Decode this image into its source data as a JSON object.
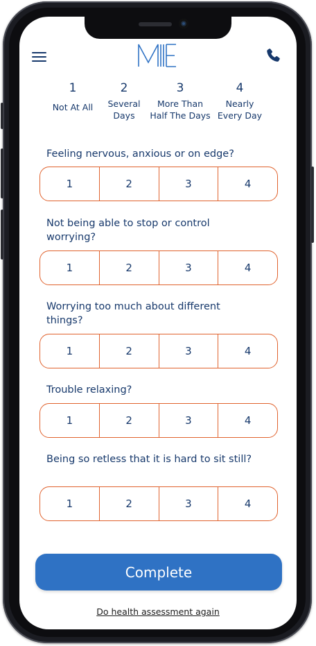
{
  "header": {
    "menu_icon": "hamburger-menu-icon",
    "logo_text": "ME",
    "phone_icon": "phone-icon",
    "accent_color": "#16386b"
  },
  "scale": [
    {
      "number": "1",
      "line1": "Not At All",
      "line2": ""
    },
    {
      "number": "2",
      "line1": "Several",
      "line2": "Days"
    },
    {
      "number": "3",
      "line1": "More Than",
      "line2": "Half The Days"
    },
    {
      "number": "4",
      "line1": "Nearly",
      "line2": "Every Day"
    }
  ],
  "questions": [
    {
      "text": "Feeling nervous, anxious or on edge?",
      "options": [
        "1",
        "2",
        "3",
        "4"
      ]
    },
    {
      "text": "Not being able to stop or control worrying?",
      "options": [
        "1",
        "2",
        "3",
        "4"
      ]
    },
    {
      "text": "Worrying too much about different things?",
      "options": [
        "1",
        "2",
        "3",
        "4"
      ]
    },
    {
      "text": "Trouble relaxing?",
      "options": [
        "1",
        "2",
        "3",
        "4"
      ]
    },
    {
      "text": "Being so retless that it is hard to sit still?",
      "options": [
        "1",
        "2",
        "3",
        "4"
      ]
    }
  ],
  "actions": {
    "complete_label": "Complete",
    "complete_color": "#2f72c4",
    "redo_link": "Do health assessment again"
  },
  "colors": {
    "option_border": "#e0622d",
    "text": "#16386b"
  }
}
